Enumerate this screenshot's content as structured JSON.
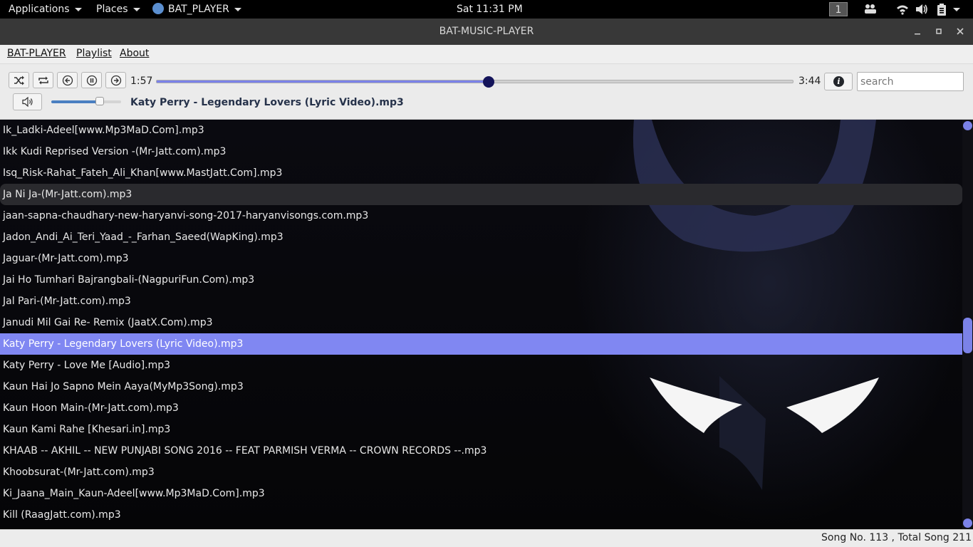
{
  "topbar": {
    "applications": "Applications",
    "places": "Places",
    "app_name": "BAT_PLAYER",
    "clock": "Sat 11:31 PM",
    "workspace": "1"
  },
  "window": {
    "title": "BAT-MUSIC-PLAYER"
  },
  "menubar": {
    "items": [
      {
        "label": "BAT-PLAYER"
      },
      {
        "label": "Playlist"
      },
      {
        "label": "About"
      }
    ]
  },
  "player": {
    "elapsed": "1:57",
    "total": "3:44",
    "progress_fraction": 0.522,
    "volume_fraction": 0.69,
    "search_placeholder": "search",
    "now_playing": "Katy Perry - Legendary Lovers (Lyric Video).mp3"
  },
  "playlist": {
    "items": [
      {
        "title": "Ik_Ladki-Adeel[www.Mp3MaD.Com].mp3"
      },
      {
        "title": "Ikk Kudi  Reprised Version -(Mr-Jatt.com).mp3"
      },
      {
        "title": "Isq_Risk-Rahat_Fateh_Ali_Khan[www.MastJatt.Com].mp3"
      },
      {
        "title": "Ja Ni Ja-(Mr-Jatt.com).mp3"
      },
      {
        "title": "jaan-sapna-chaudhary-new-haryanvi-song-2017-haryanvisongs.com.mp3"
      },
      {
        "title": "Jadon_Andi_Ai_Teri_Yaad_-_Farhan_Saeed(WapKing).mp3"
      },
      {
        "title": "Jaguar-(Mr-Jatt.com).mp3"
      },
      {
        "title": "Jai Ho Tumhari Bajrangbali-(NagpuriFun.Com).mp3"
      },
      {
        "title": "Jal Pari-(Mr-Jatt.com).mp3"
      },
      {
        "title": "Janudi Mil Gai Re- Remix (JaatX.Com).mp3"
      },
      {
        "title": "Katy Perry - Legendary Lovers (Lyric Video).mp3"
      },
      {
        "title": "Katy Perry - Love Me [Audio].mp3"
      },
      {
        "title": "Kaun Hai Jo Sapno Mein Aaya(MyMp3Song).mp3"
      },
      {
        "title": "Kaun Hoon Main-(Mr-Jatt.com).mp3"
      },
      {
        "title": "Kaun Kami Rahe [Khesari.in].mp3"
      },
      {
        "title": "KHAAB -- AKHIL -- NEW PUNJABI SONG 2016 -- FEAT PARMISH VERMA -- CROWN RECORDS --.mp3"
      },
      {
        "title": "Khoobsurat-(Mr-Jatt.com).mp3"
      },
      {
        "title": "Ki_Jaana_Main_Kaun-Adeel[www.Mp3MaD.Com].mp3"
      },
      {
        "title": "Kill (RaagJatt.com).mp3"
      }
    ],
    "hover_index": 3,
    "selected_index": 10
  },
  "statusbar": {
    "text": "Song No. 113 ,  Total Song 211"
  },
  "colors": {
    "accent": "#7b82e8",
    "selected_row": "#8087f2",
    "progress_knob": "#14145a",
    "topbar": "#000000",
    "titlebar": "#383838"
  }
}
